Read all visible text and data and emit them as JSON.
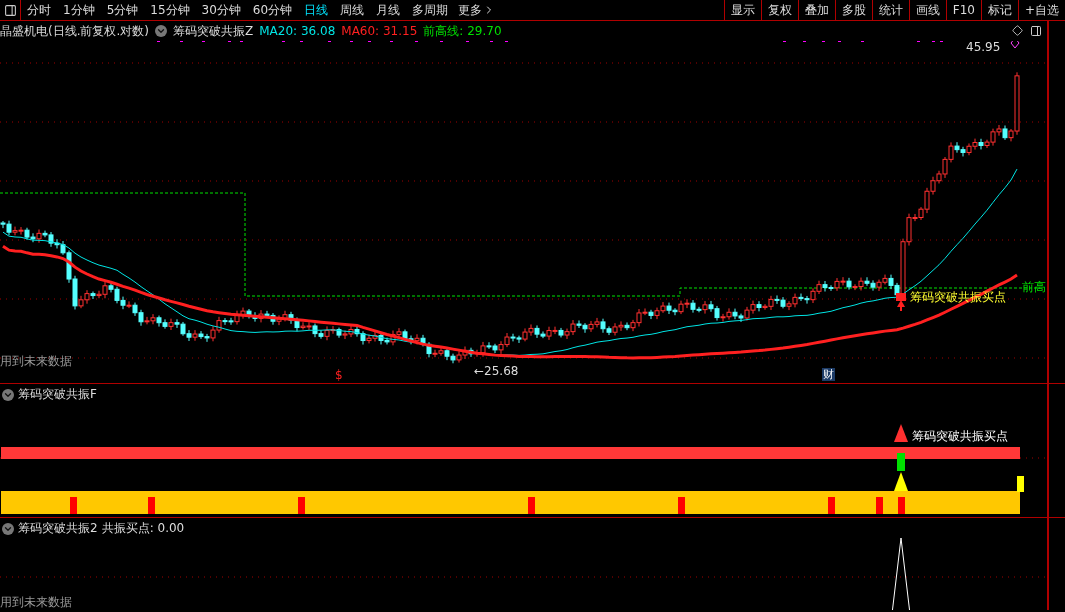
{
  "toolbar": {
    "periods": [
      {
        "label": "分时",
        "selected": false
      },
      {
        "label": "1分钟",
        "selected": false
      },
      {
        "label": "5分钟",
        "selected": false
      },
      {
        "label": "15分钟",
        "selected": false
      },
      {
        "label": "30分钟",
        "selected": false
      },
      {
        "label": "60分钟",
        "selected": false
      },
      {
        "label": "日线",
        "selected": true
      },
      {
        "label": "周线",
        "selected": false
      },
      {
        "label": "月线",
        "selected": false
      },
      {
        "label": "多周期",
        "selected": false
      }
    ],
    "more": "更多",
    "buttons": [
      "显示",
      "复权",
      "叠加",
      "多股",
      "统计",
      "画线",
      "F10",
      "标记",
      "+自选"
    ]
  },
  "main_chart": {
    "title": "晶盛机电(日线.前复权.对数)",
    "indicator": "筹码突破共振Z",
    "legend": [
      {
        "label": "MA20: 36.08",
        "color": "#00e5e5"
      },
      {
        "label": "MA60: 31.15",
        "color": "#ff2020"
      },
      {
        "label": "前高线: 29.70",
        "color": "#00e000"
      }
    ],
    "high_label": "45.95",
    "low_label": "←25.68",
    "prev_high_label": "前高",
    "signal_label": "筹码突破共振买点",
    "future_data_note": "用到未来数据",
    "dividend_mark": "$",
    "finance_mark": "财"
  },
  "signal_panel": {
    "title": "筹码突破共振F",
    "signal_label": "筹码突破共振买点"
  },
  "resonance_panel": {
    "title": "筹码突破共振2",
    "reading": "共振买点: 0.00",
    "future_data_note": "用到未来数据"
  }
}
